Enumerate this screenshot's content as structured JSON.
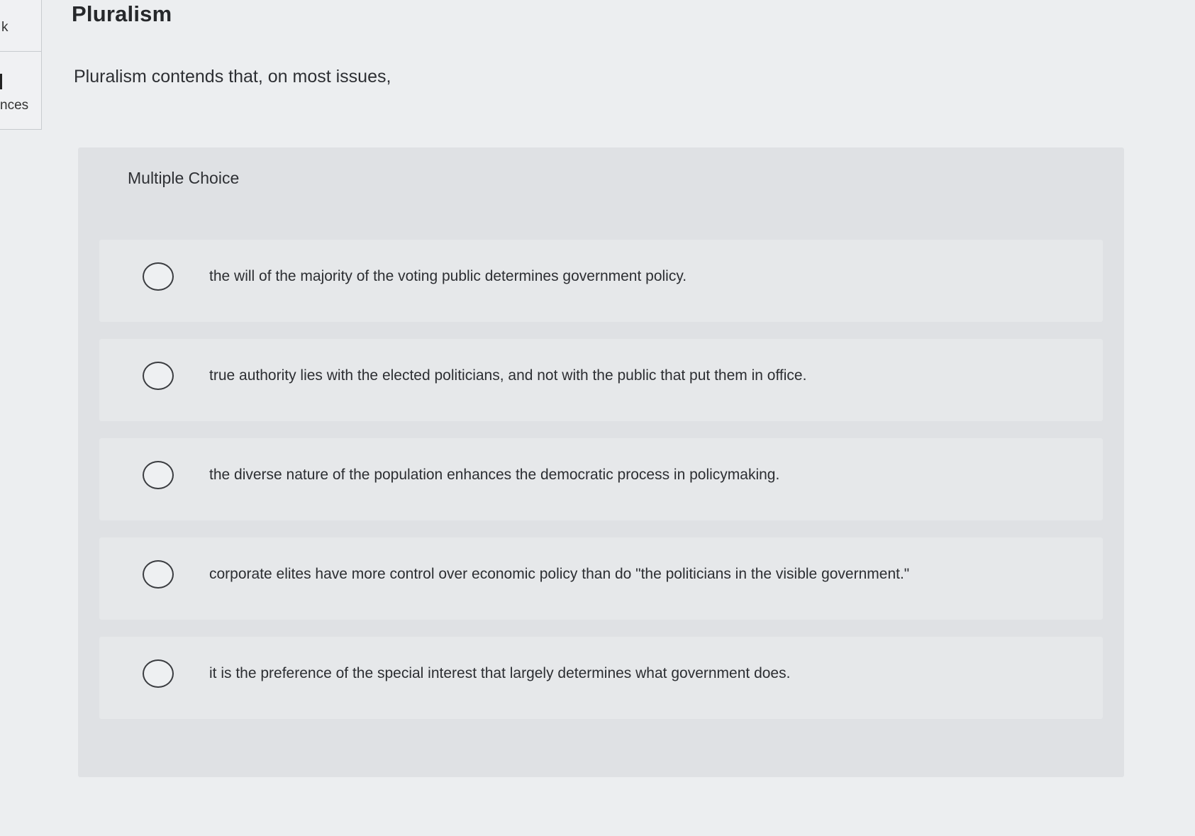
{
  "sidebar": {
    "tab_top_fragment": "k",
    "tab_bottom_fragment": "nces"
  },
  "question": {
    "title": "Pluralism",
    "prompt": "Pluralism contends that, on most issues,",
    "type_label": "Multiple Choice",
    "choices": [
      {
        "text": "the will of the majority of the voting public determines government policy."
      },
      {
        "text": "true authority lies with the elected politicians, and not with the public that put them in office."
      },
      {
        "text": "the diverse nature of the population enhances the democratic process in policymaking."
      },
      {
        "text": "corporate elites have more control over economic policy than do \"the politicians in the visible government.\""
      },
      {
        "text": "it is the preference of the special interest that largely determines what government does."
      }
    ]
  },
  "colors": {
    "page_background": "#eceef0",
    "card_background": "#dfe1e4",
    "text": "#2b2d30"
  }
}
